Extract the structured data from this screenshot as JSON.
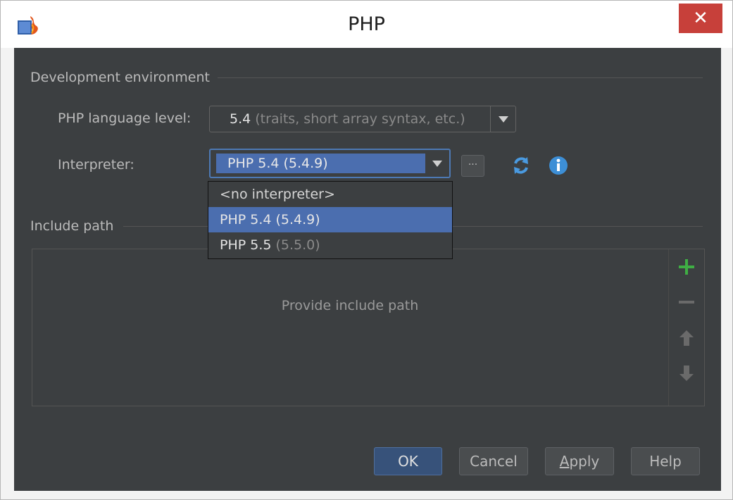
{
  "window": {
    "title": "PHP",
    "close_glyph": "✕"
  },
  "icons": {
    "app": "php-app-icon",
    "close": "close-icon",
    "browse": "ellipsis-icon",
    "refresh": "refresh-icon",
    "info": "info-icon",
    "add": "plus-icon",
    "remove": "minus-icon",
    "up": "arrow-up-icon",
    "down": "arrow-down-icon"
  },
  "dev_env": {
    "section_title": "Development environment",
    "language_level_label": "PHP language level:",
    "language_level_value": "5.4",
    "language_level_hint": "(traits, short array syntax, etc.)",
    "interpreter_label": "Interpreter:",
    "interpreter_value": "PHP 5.4 (5.4.9)",
    "browse_glyph": "···"
  },
  "interpreter_dropdown": {
    "items": [
      {
        "name": "<no interpreter>",
        "version": ""
      },
      {
        "name": "PHP 5.4",
        "version": "(5.4.9)"
      },
      {
        "name": "PHP 5.5",
        "version": "(5.5.0)"
      }
    ],
    "selected_index": 1
  },
  "include_path": {
    "section_title": "Include path",
    "empty_text": "Provide include path"
  },
  "buttons": {
    "ok": "OK",
    "cancel": "Cancel",
    "apply_mnemonic": "A",
    "apply_rest": "pply",
    "help": "Help"
  },
  "colors": {
    "background": "#3c3f41",
    "selection": "#4b6eaf",
    "close_button": "#c7403a",
    "add_icon": "#3fae44",
    "info_icon": "#3d8fd6"
  }
}
